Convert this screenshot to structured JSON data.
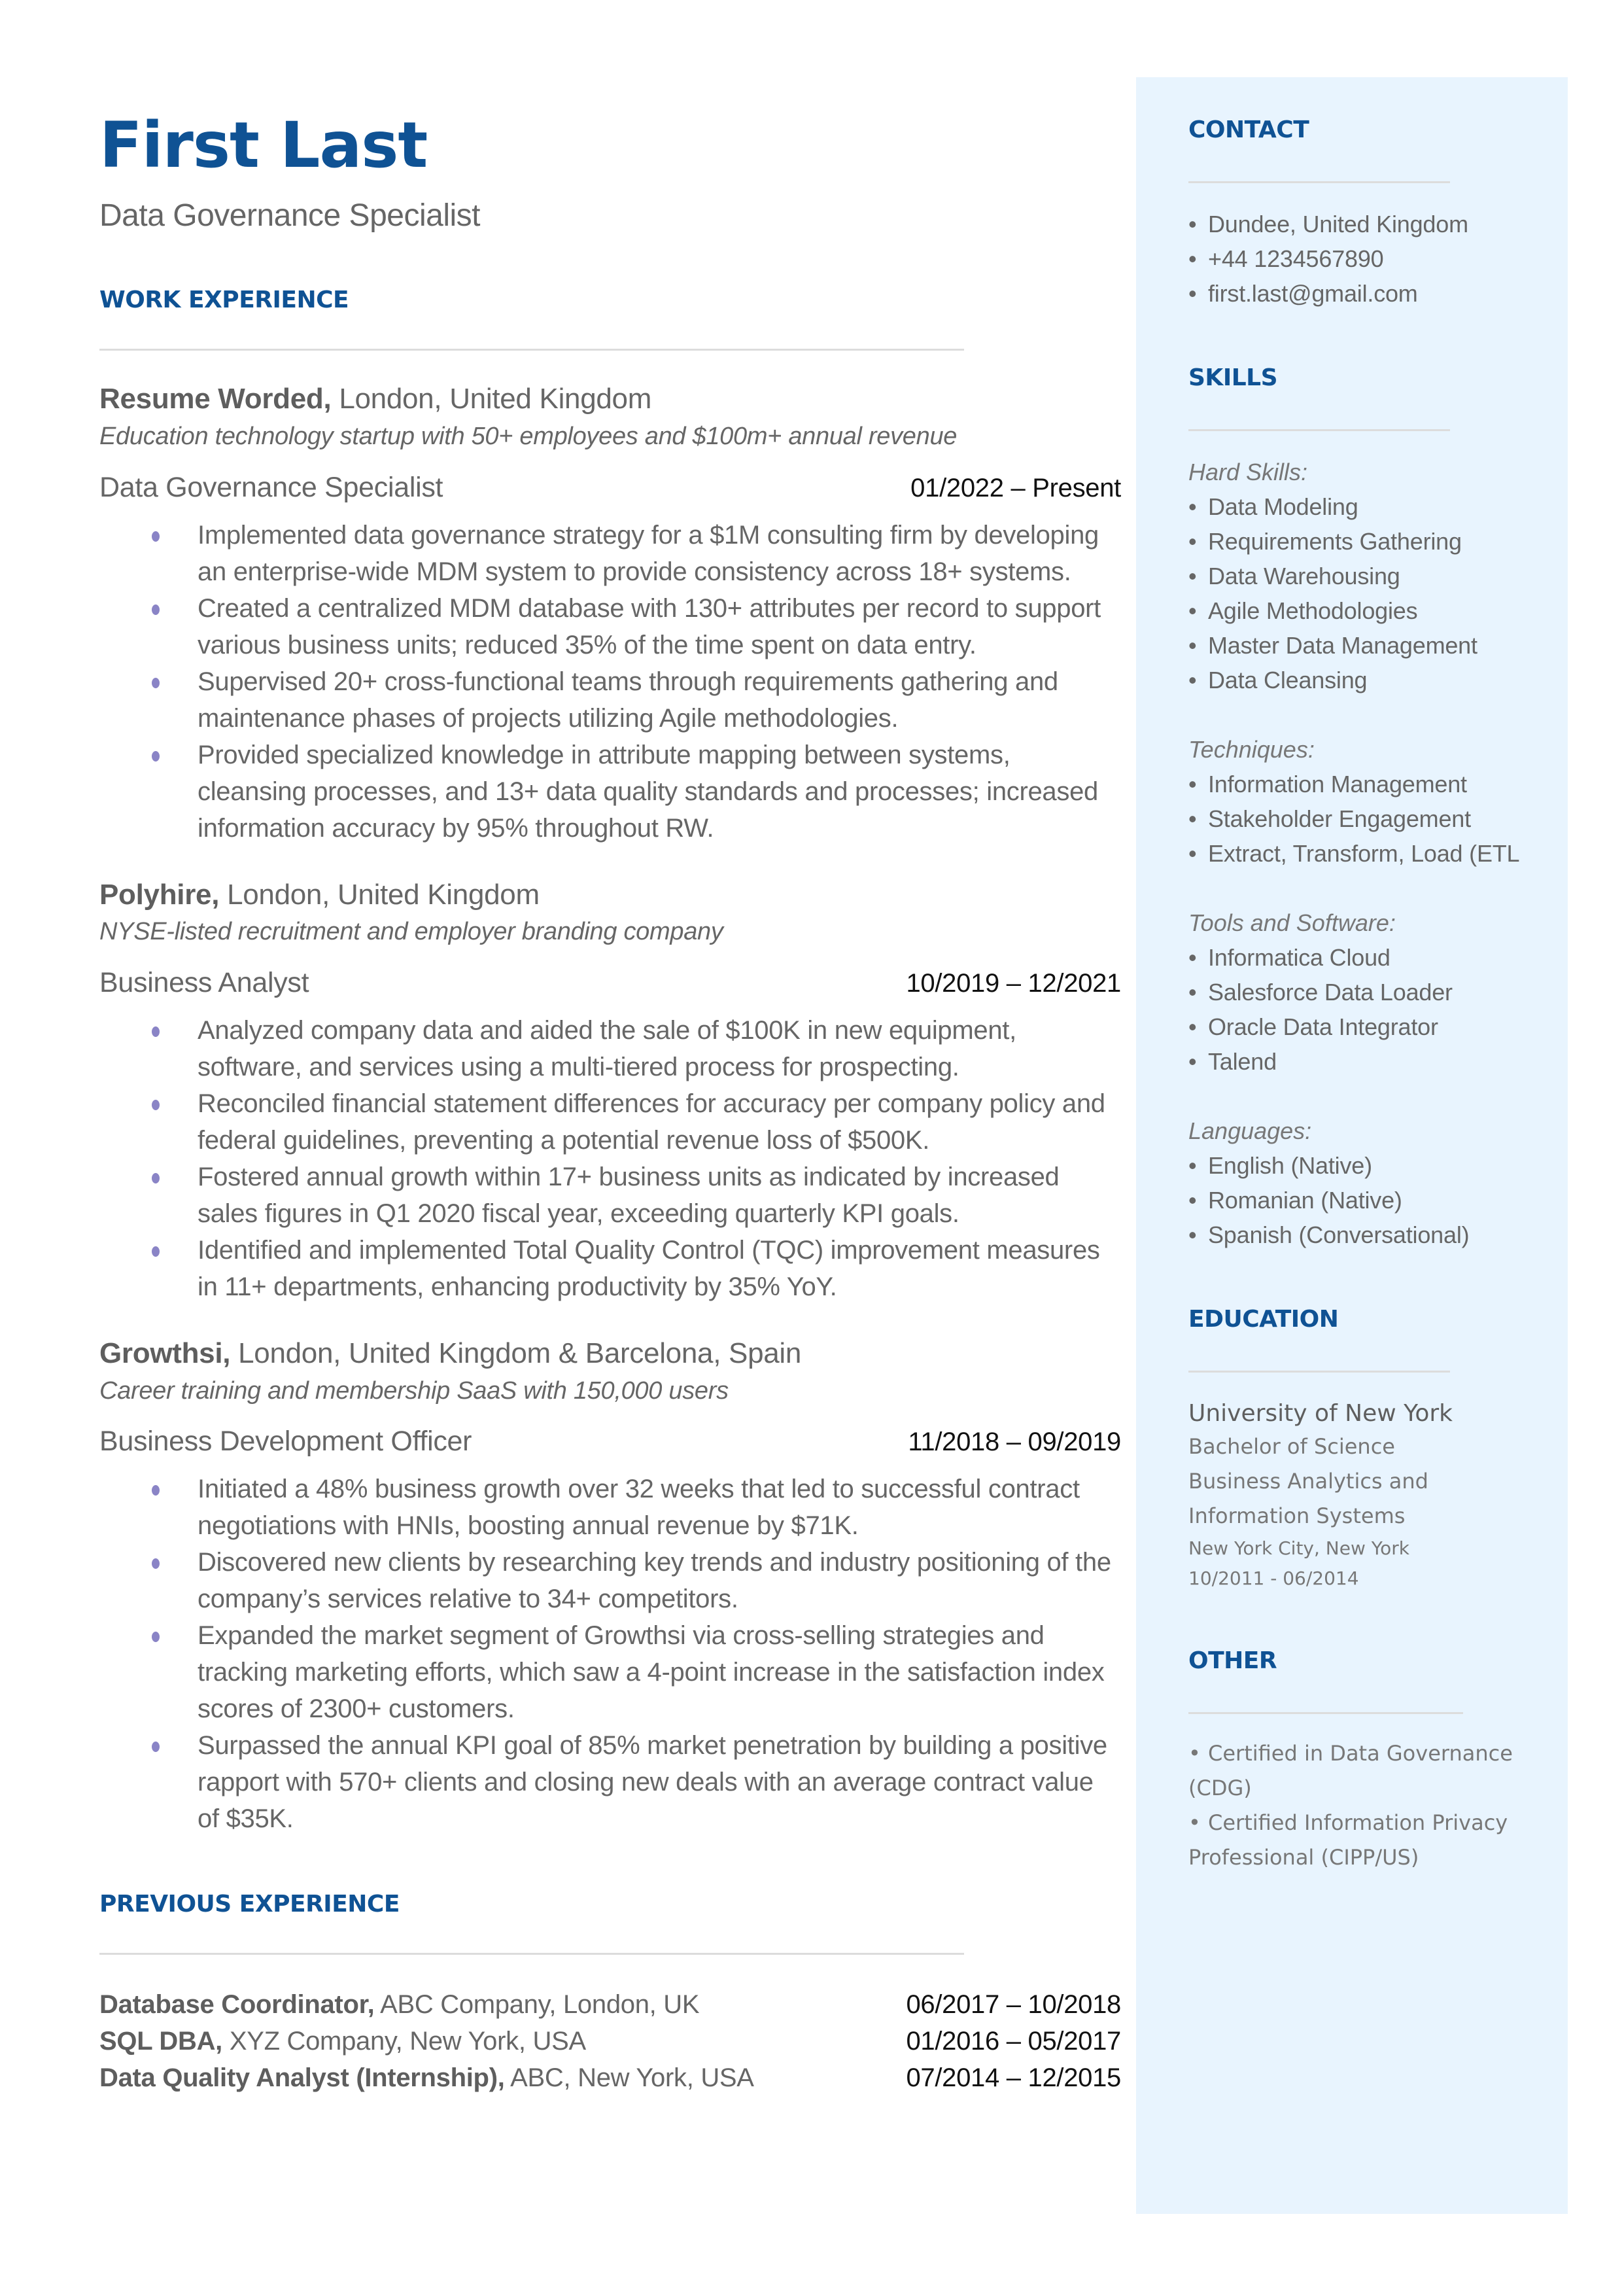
{
  "header": {
    "name": "First Last",
    "title": "Data Governance Specialist"
  },
  "work_experience": {
    "heading": "WORK EXPERIENCE",
    "jobs": [
      {
        "company": "Resume Worded,",
        "location": " London, United Kingdom",
        "description": "Education technology startup with 50+ employees and $100m+ annual revenue",
        "role": "Data Governance Specialist",
        "dates": "01/2022 – Present",
        "bullets": [
          "Implemented data governance strategy for a $1M consulting firm by developing an enterprise-wide MDM system to provide consistency across 18+ systems.",
          "Created a centralized MDM database with 130+ attributes per record to support various business units; reduced 35% of the time spent on data entry.",
          "Supervised 20+ cross-functional teams through requirements gathering and maintenance phases of projects utilizing Agile methodologies.",
          "Provided specialized knowledge in attribute mapping between systems, cleansing processes, and 13+ data quality standards and processes; increased information accuracy by 95% throughout RW."
        ]
      },
      {
        "company": "Polyhire,",
        "location": " London, United Kingdom",
        "description": "NYSE-listed recruitment and employer branding company",
        "role": "Business Analyst",
        "dates": "10/2019 – 12/2021",
        "bullets": [
          "Analyzed company data and aided the sale of $100K in new equipment, software, and services using a multi-tiered process for prospecting.",
          "Reconciled financial statement differences for accuracy per company policy and federal guidelines, preventing a potential revenue loss of $500K.",
          "Fostered annual growth within 17+ business units as indicated by increased sales figures in Q1 2020 fiscal year, exceeding quarterly KPI goals.",
          "Identified and implemented Total Quality Control (TQC) improvement measures in 11+ departments, enhancing productivity by 35% YoY."
        ]
      },
      {
        "company": "Growthsi,",
        "location": " London, United Kingdom & Barcelona, Spain",
        "description": "Career training and membership SaaS with 150,000 users",
        "role": "Business Development Officer",
        "dates": "11/2018 – 09/2019",
        "bullets": [
          "Initiated a 48% business growth over 32 weeks that led to successful contract negotiations with HNIs, boosting annual revenue by $71K.",
          "Discovered new clients by researching key trends and industry positioning of the company’s services relative to 34+ competitors.",
          "Expanded the market segment of Growthsi via cross-selling strategies and tracking marketing efforts, which saw a 4-point increase in the satisfaction index scores of 2300+ customers.",
          "Surpassed the annual KPI goal of 85% market penetration by building a positive rapport with 570+ clients and closing new deals with an average contract value of $35K."
        ]
      }
    ]
  },
  "previous_experience": {
    "heading": "PREVIOUS EXPERIENCE",
    "items": [
      {
        "role": "Database Coordinator,",
        "details": " ABC Company, London, UK",
        "dates": "06/2017 – 10/2018"
      },
      {
        "role": "SQL DBA,",
        "details": " XYZ Company, New York, USA",
        "dates": "01/2016 – 05/2017"
      },
      {
        "role": "Data Quality Analyst (Internship),",
        "details": " ABC, New York, USA",
        "dates": "07/2014 – 12/2015"
      }
    ]
  },
  "sidebar": {
    "bullet_glyph": "•",
    "contact": {
      "heading": "CONTACT",
      "items": [
        "Dundee, United Kingdom",
        "+44 1234567890",
        "first.last@gmail.com"
      ]
    },
    "skills": {
      "heading": "SKILLS",
      "categories": [
        {
          "label": "Hard Skills:",
          "items": [
            "Data Modeling",
            "Requirements Gathering",
            "Data Warehousing",
            "Agile Methodologies",
            "Master Data Management",
            "Data Cleansing"
          ]
        },
        {
          "label": "Techniques:",
          "items": [
            "Information Management",
            "Stakeholder Engagement",
            "Extract, Transform, Load (ETL"
          ]
        },
        {
          "label": "Tools and Software:",
          "items": [
            "Informatica Cloud",
            "Salesforce Data Loader",
            "Oracle Data Integrator",
            "Talend"
          ]
        },
        {
          "label": "Languages:",
          "items": [
            "English (Native)",
            "Romanian (Native)",
            "Spanish (Conversational)"
          ]
        }
      ]
    },
    "education": {
      "heading": "EDUCATION",
      "school": "University of New York",
      "degree": "Bachelor of Science",
      "field_line1": "Business Analytics and",
      "field_line2": "Information Systems",
      "location": "New York City, New York",
      "dates": "10/2011 - 06/2014"
    },
    "other": {
      "heading": "OTHER",
      "items": [
        "Certified in Data Governance (CDG)",
        "Certified Information Privacy Professional (CIPP/US)"
      ]
    }
  },
  "colors": {
    "accent": "#0f5294",
    "bullet": "#8a84c6",
    "sidebar_bg": "#e8f4fe",
    "text": "#666666"
  }
}
